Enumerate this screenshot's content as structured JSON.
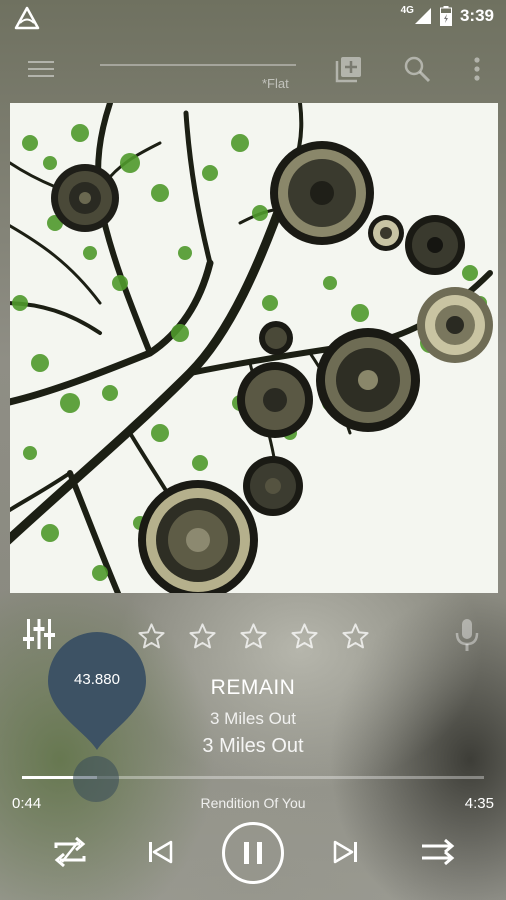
{
  "status_bar": {
    "network_label": "4G",
    "time": "3:39"
  },
  "toolbar": {
    "preset_label": "*Flat"
  },
  "rating": {
    "stars_filled": 0,
    "stars_total": 5
  },
  "seek": {
    "bubble_value": "43.880",
    "progress_fraction": 0.163
  },
  "track": {
    "title": "REMAIN",
    "artist": "3 Miles Out",
    "album": "3 Miles Out",
    "elapsed": "0:44",
    "duration": "4:35",
    "next_track": "Rendition Of You"
  },
  "icons": {
    "app_logo": "app-logo-icon",
    "signal": "signal-icon",
    "battery": "battery-icon",
    "menu": "menu-icon",
    "add_queue": "add-to-queue-icon",
    "search": "search-icon",
    "more": "more-vert-icon",
    "equalizer": "equalizer-icon",
    "microphone": "microphone-icon",
    "repeat": "repeat-icon",
    "previous": "skip-previous-icon",
    "pause": "pause-icon",
    "next": "skip-next-icon",
    "shuffle": "shuffle-icon"
  },
  "colors": {
    "bubble": "#3d5264",
    "text": "#ffffff"
  }
}
